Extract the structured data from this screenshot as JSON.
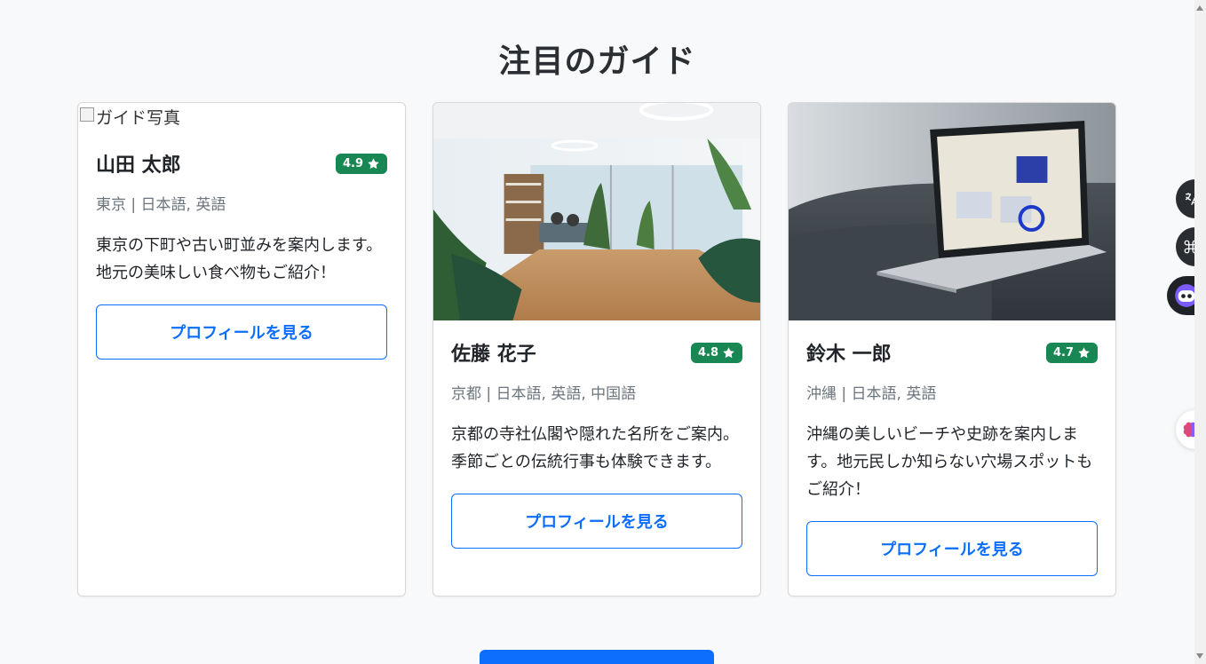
{
  "section": {
    "title": "注目のガイド"
  },
  "guides": [
    {
      "name": "山田 太郎",
      "rating": "4.9",
      "meta": "東京 | 日本語, 英語",
      "description": "東京の下町や古い町並みを案内します。地元の美味しい食べ物もご紹介！",
      "image_alt": "ガイド写真",
      "button": "プロフィールを見る"
    },
    {
      "name": "佐藤 花子",
      "rating": "4.8",
      "meta": "京都 | 日本語, 英語, 中国語",
      "description": "京都の寺社仏閣や隠れた名所をご案内。季節ごとの伝統行事も体験できます。",
      "button": "プロフィールを見る"
    },
    {
      "name": "鈴木 一郎",
      "rating": "4.7",
      "meta": "沖縄 | 日本語, 英語",
      "description": "沖縄の美しいビーチや史跡を案内します。地元民しか知らない穴場スポットもご紹介！",
      "button": "プロフィールを見る"
    }
  ],
  "colors": {
    "primary": "#0d6efd",
    "rating_bg": "#198754",
    "page_bg": "#f8f9fa"
  },
  "icons": {
    "rating": "star-icon"
  }
}
